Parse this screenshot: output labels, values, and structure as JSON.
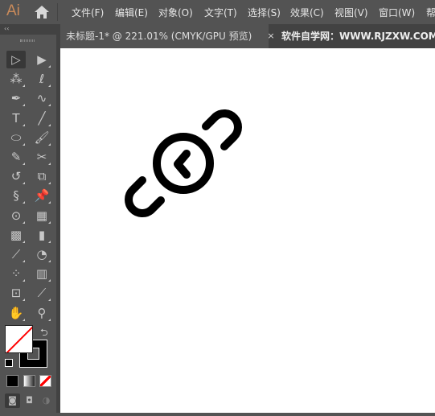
{
  "app": {
    "logo": "Ai"
  },
  "menu": [
    "文件(F)",
    "编辑(E)",
    "对象(O)",
    "文字(T)",
    "选择(S)",
    "效果(C)",
    "视图(V)",
    "窗口(W)",
    "帮"
  ],
  "tabs": [
    {
      "label": "未标题-1* @ 221.01% (CMYK/GPU 预览)",
      "close": "×"
    },
    {
      "label": "软件自学网：WWW.RJZXW.COM"
    }
  ],
  "panel": {
    "collapse": "‹‹"
  },
  "tools": [
    [
      "selection-tool",
      "▷"
    ],
    [
      "direct-selection-tool",
      "▶"
    ],
    [
      "magic-wand-tool",
      "⁂"
    ],
    [
      "lasso-tool",
      "ℓ"
    ],
    [
      "pen-tool",
      "✒"
    ],
    [
      "curvature-tool",
      "∿"
    ],
    [
      "type-tool",
      "T"
    ],
    [
      "line-segment-tool",
      "╱"
    ],
    [
      "ellipse-tool",
      "⬭"
    ],
    [
      "paintbrush-tool",
      "🖌"
    ],
    [
      "shaper-tool",
      "✎"
    ],
    [
      "scissors-tool",
      "✂"
    ],
    [
      "rotate-tool",
      "↺"
    ],
    [
      "scale-tool",
      "⧉"
    ],
    [
      "warp-tool",
      "§"
    ],
    [
      "puppet-warp-tool",
      "📌"
    ],
    [
      "shape-builder-tool",
      "⊙"
    ],
    [
      "perspective-grid-tool",
      "▦"
    ],
    [
      "mesh-tool",
      "▩"
    ],
    [
      "gradient-tool",
      "▮"
    ],
    [
      "eyedropper-tool",
      "⟋"
    ],
    [
      "blend-tool",
      "◔"
    ],
    [
      "symbol-sprayer-tool",
      "⁘"
    ],
    [
      "column-graph-tool",
      "▥"
    ],
    [
      "artboard-tool",
      "⊡"
    ],
    [
      "slice-tool",
      "⟋"
    ],
    [
      "hand-tool",
      "✋"
    ],
    [
      "zoom-tool",
      "⚲"
    ]
  ],
  "colors": {
    "fill": "#ffffff",
    "stroke": "#000000",
    "none_slash": "#ff0000",
    "accent": "#c98a5a"
  },
  "swap": "⮌"
}
